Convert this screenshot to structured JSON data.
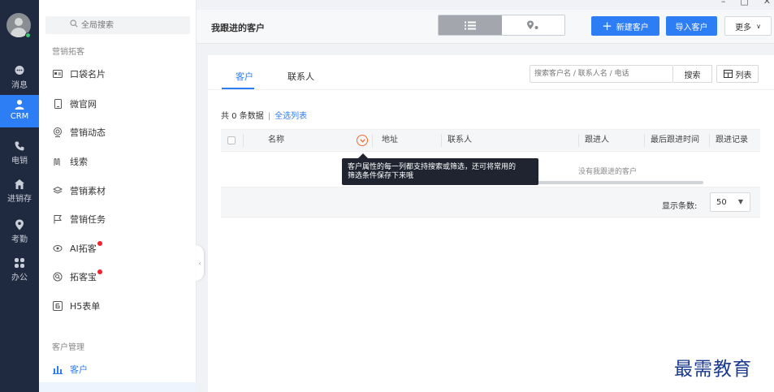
{
  "window": {
    "controls": [
      "–",
      "□",
      "✕"
    ]
  },
  "rail": {
    "items": [
      {
        "label": "消息",
        "icon": "message-icon"
      },
      {
        "label": "CRM",
        "icon": "crm-user-icon",
        "active": true
      },
      {
        "label": "电销",
        "icon": "phone-icon"
      },
      {
        "label": "进销存",
        "icon": "home-icon"
      },
      {
        "label": "考勤",
        "icon": "location-pin-icon"
      },
      {
        "label": "办公",
        "icon": "apps-grid-icon"
      }
    ]
  },
  "sidebar": {
    "search_placeholder": "全局搜索",
    "group_marketing": "营销拓客",
    "items": [
      {
        "label": "口袋名片",
        "icon": "card-icon"
      },
      {
        "label": "微官网",
        "icon": "mobile-icon"
      },
      {
        "label": "营销动态",
        "icon": "radar-icon"
      },
      {
        "label": "线索",
        "icon": "clue-icon"
      },
      {
        "label": "营销素材",
        "icon": "layers-icon"
      },
      {
        "label": "营销任务",
        "icon": "flag-icon"
      },
      {
        "label": "AI拓客",
        "icon": "ai-icon",
        "badge": true
      },
      {
        "label": "拓客宝",
        "icon": "search-circle-icon",
        "badge": true
      },
      {
        "label": "H5表单",
        "icon": "form-icon"
      }
    ],
    "group_customer": "客户管理",
    "customer_item": {
      "label": "客户",
      "icon": "bar-chart-icon"
    }
  },
  "header": {
    "title": "我跟进的客户",
    "new_customer": "新建客户",
    "import_customer": "导入客户",
    "more": "更多"
  },
  "tabs": [
    {
      "label": "客户",
      "active": true
    },
    {
      "label": "联系人"
    }
  ],
  "search": {
    "placeholder": "搜索客户名 / 联系人名 / 电话",
    "button": "搜索",
    "list_button": "列表"
  },
  "summary": {
    "count_text": "共 0 条数据",
    "separator": "|",
    "select_all": "全选列表"
  },
  "table": {
    "columns": [
      "名称",
      "地址",
      "联系人",
      "跟进人",
      "最后跟进时间",
      "跟进记录"
    ],
    "empty_text": "没有我跟进的客户"
  },
  "footer": {
    "page_size_label": "显示条数:",
    "page_size_value": "50"
  },
  "tooltip": {
    "line1": "客户属性的每一列都支持搜索或筛选，还可将常用的",
    "line2": "筛选条件保存下来哦"
  },
  "watermark": "最需教育",
  "colors": {
    "primary": "#2d7df4",
    "rail": "#1f2a40",
    "accent": "#f26b2a"
  }
}
